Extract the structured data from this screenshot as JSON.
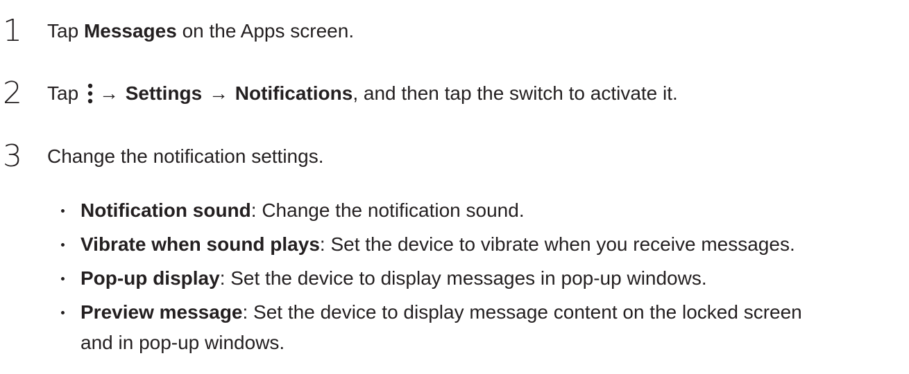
{
  "steps": [
    {
      "number": "1",
      "pre": "Tap ",
      "bold": "Messages",
      "post": " on the Apps screen."
    },
    {
      "number": "2",
      "pre": "Tap ",
      "icon": "more-options-icon",
      "arrow1": "→",
      "bold1": "Settings",
      "arrow2": "→",
      "bold2": "Notifications",
      "post": ", and then tap the switch to activate it."
    },
    {
      "number": "3",
      "text": "Change the notification settings."
    }
  ],
  "bullets": [
    {
      "bold": "Notification sound",
      "text": ": Change the notification sound."
    },
    {
      "bold": "Vibrate when sound plays",
      "text": ": Set the device to vibrate when you receive messages."
    },
    {
      "bold": "Pop-up display",
      "text": ": Set the device to display messages in pop-up windows."
    },
    {
      "bold": "Preview message",
      "text": ": Set the device to display message content on the locked screen",
      "continuation": "and in pop-up windows."
    }
  ]
}
